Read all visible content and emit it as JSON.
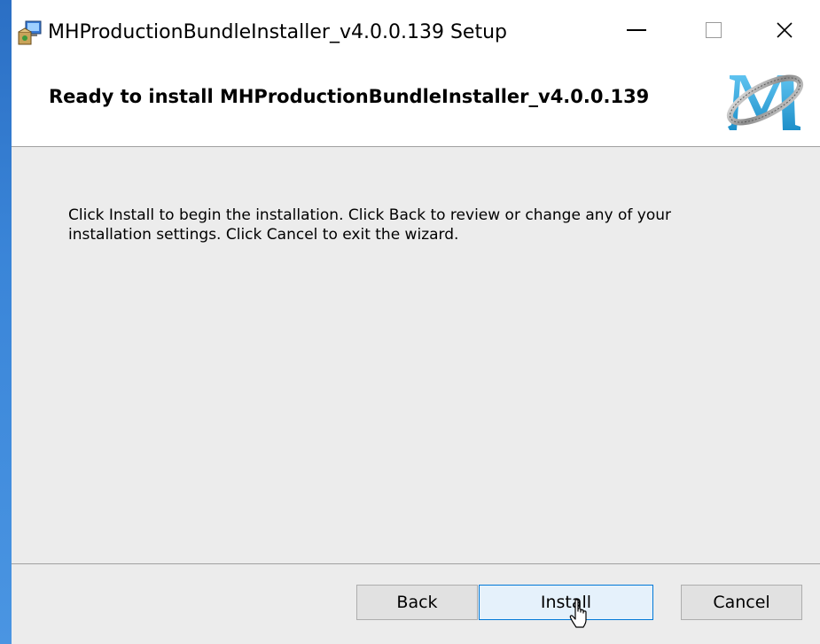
{
  "window": {
    "title": "MHProductionBundleInstaller_v4.0.0.139 Setup",
    "icon": "installer-icon",
    "controls": {
      "minimize": "minimize-icon",
      "maximize": "maximize-icon",
      "close": "close-icon"
    }
  },
  "header": {
    "title": "Ready to install MHProductionBundleInstaller_v4.0.0.139",
    "logo": "mh-logo"
  },
  "content": {
    "instructions": "Click Install to begin the installation. Click Back to review or change any of your installation settings. Click Cancel to exit the wizard."
  },
  "buttons": {
    "back": "Back",
    "install": "Install",
    "cancel": "Cancel"
  },
  "colors": {
    "accent": "#0078d7",
    "content_bg": "#ececec",
    "logo_blue": "#2a9fd6"
  }
}
